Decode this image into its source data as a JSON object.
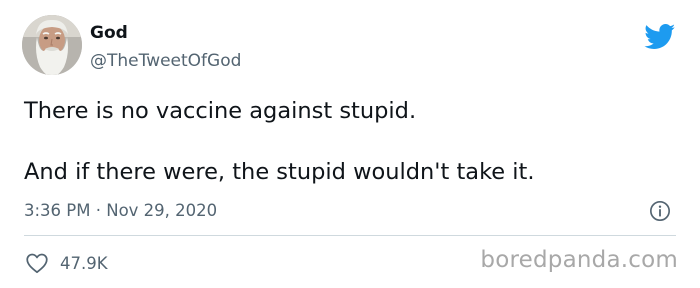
{
  "author": {
    "name": "God",
    "handle": "@TheTweetOfGod",
    "avatar_icon": "bearded-old-man-avatar"
  },
  "tweet": {
    "line1": "There is no vaccine against stupid.",
    "line2": "And if there were, the stupid wouldn't take it."
  },
  "meta": {
    "time": "3:36 PM",
    "separator": "·",
    "date": "Nov 29, 2020"
  },
  "stats": {
    "likes": "47.9K"
  },
  "icons": {
    "brand": "twitter-bird-icon",
    "info": "info-icon",
    "like": "heart-icon"
  },
  "colors": {
    "twitter_blue": "#1d9bf0",
    "text_primary": "#0f1419",
    "text_secondary": "#536471",
    "divider": "#cfd9de",
    "watermark": "#a8a8a8"
  },
  "watermark": "boredpanda.com"
}
